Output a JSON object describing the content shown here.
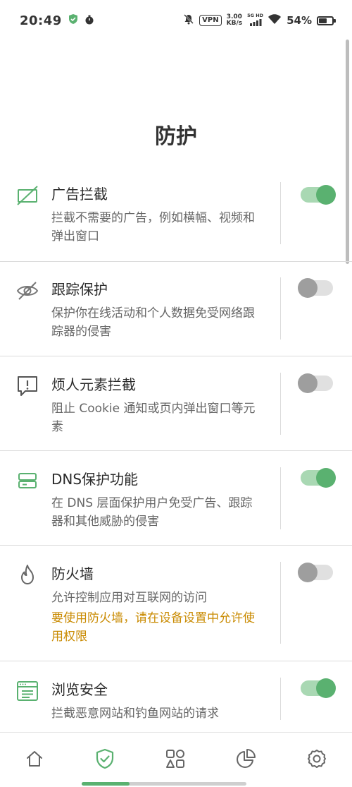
{
  "status": {
    "time": "20:49",
    "vpn": "VPN",
    "speed_value": "3.00",
    "speed_unit": "KB/s",
    "network": "5G HD",
    "battery_pct": "54%",
    "battery_level": 0.54
  },
  "title": "防护",
  "features": [
    {
      "title": "广告拦截",
      "desc": "拦截不需要的广告，例如横幅、视频和弹出窗口",
      "enabled": true
    },
    {
      "title": "跟踪保护",
      "desc": "保护你在线活动和个人数据免受网络跟踪器的侵害",
      "enabled": false
    },
    {
      "title": "烦人元素拦截",
      "desc": "阻止 Cookie 通知或页内弹出窗口等元素",
      "enabled": false
    },
    {
      "title": "DNS保护功能",
      "desc": "在 DNS 层面保护用户免受广告、跟踪器和其他威胁的侵害",
      "enabled": true
    },
    {
      "title": "防火墙",
      "desc": "允许控制应用对互联网的访问",
      "warning": "要使用防火墙，请在设备设置中允许使用权限",
      "enabled": false
    },
    {
      "title": "浏览安全",
      "desc": "拦截恶意网站和钓鱼网站的请求",
      "enabled": true
    }
  ],
  "nav": {
    "items": [
      "home-icon",
      "shield-check-icon",
      "apps-icon",
      "pie-chart-icon",
      "gear-icon"
    ],
    "active_index": 1
  },
  "colors": {
    "accent": "#5ab170",
    "accent_light": "#a9d8b3",
    "warning": "#c98a00"
  }
}
